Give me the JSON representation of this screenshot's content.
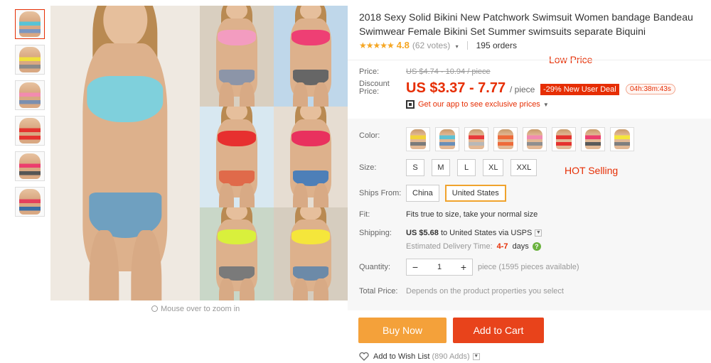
{
  "product": {
    "title": "2018 Sexy Solid Bikini New Patchwork Swimsuit Women bandage Bandeau Swimwear Female Bikini Set Summer swimsuits separate Biquini",
    "rating_value": "4.8",
    "votes": "(62 votes)",
    "orders": "195 orders"
  },
  "gallery": {
    "zoom_hint": "Mouse over to zoom in",
    "thumbnails": [
      {
        "top": "#58c3d6",
        "bottom": "#7a96c2"
      },
      {
        "top": "#f0e13c",
        "bottom": "#8a8a8a"
      },
      {
        "top": "#f28bb0",
        "bottom": "#7b8fb0"
      },
      {
        "top": "#e5332f",
        "bottom": "#e5332f"
      },
      {
        "top": "#ec3e6e",
        "bottom": "#555555"
      },
      {
        "top": "#e5405c",
        "bottom": "#3a6ea5"
      }
    ],
    "photos": [
      {
        "top": "#7fd0dc",
        "bottom": "#6fa0c0",
        "bg": "#efe9e1"
      },
      {
        "top": "#f39cc0",
        "bottom": "#8c95a8",
        "bg": "#d9cfc0"
      },
      {
        "top": "#ee3f74",
        "bottom": "#666666",
        "bg": "#bfd7ea"
      },
      {
        "top": "#e7302f",
        "bottom": "#e06a4a",
        "bg": "#d8e8f1"
      },
      {
        "top": "#e9315e",
        "bottom": "#4d7fb8",
        "bg": "#e6ddd2"
      },
      {
        "top": "#d9f03c",
        "bottom": "#7a7a7a",
        "bg": "#c9d7c8"
      },
      {
        "top": "#f5e63b",
        "bottom": "#6c8aa8",
        "bg": "#d6cdbf"
      }
    ]
  },
  "price": {
    "price_label": "Price:",
    "original": "US $4.74 - 10.94 / piece",
    "discount_label": "Discount Price:",
    "discount": "US $3.37 - 7.77",
    "unit": "/ piece",
    "deal": "-29% New User Deal",
    "timer": "04h:38m:43s",
    "app_promo": "Get our app to see exclusive prices",
    "low_price_note": "Low Price"
  },
  "options": {
    "color_label": "Color:",
    "colors": [
      {
        "top": "#f2d33a",
        "bottom": "#7b7b7b"
      },
      {
        "top": "#5ec1d4",
        "bottom": "#6a8fb8"
      },
      {
        "top": "#e83a3a",
        "bottom": "#b8b8b8"
      },
      {
        "top": "#ee6b3a",
        "bottom": "#ee6b3a"
      },
      {
        "top": "#f28bb0",
        "bottom": "#8f8f8f"
      },
      {
        "top": "#e5332f",
        "bottom": "#e5332f"
      },
      {
        "top": "#ec3e6e",
        "bottom": "#5a5a5a"
      },
      {
        "top": "#f5e63b",
        "bottom": "#7f7f7f"
      }
    ],
    "size_label": "Size:",
    "sizes": [
      "S",
      "M",
      "L",
      "XL",
      "XXL"
    ],
    "hot_selling_note": "HOT Selling",
    "ships_label": "Ships From:",
    "ships": [
      "China",
      "United States"
    ],
    "fit_label": "Fit:",
    "fit_text": "Fits true to size, take your normal size",
    "shipping_label": "Shipping:",
    "shipping_cost": "US $5.68",
    "shipping_dest": "to United States via USPS",
    "delivery_label": "Estimated Delivery Time:",
    "delivery_value": "4-7",
    "delivery_unit": "days",
    "quantity_label": "Quantity:",
    "quantity_minus": "−",
    "quantity": "1",
    "quantity_plus": "+",
    "quantity_note": "piece (1595 pieces available)",
    "total_label": "Total Price:",
    "total_note": "Depends on the product properties you select"
  },
  "actions": {
    "buy_now": "Buy Now",
    "add_to_cart": "Add to Cart",
    "wishlist": "Add to Wish List",
    "wishlist_count": "(890 Adds)"
  },
  "colors": {
    "accent": "#e62e04",
    "buy": "#f4a13a",
    "cart": "#e8431b",
    "star": "#f5a623",
    "selected_border": "#f0a32d"
  }
}
